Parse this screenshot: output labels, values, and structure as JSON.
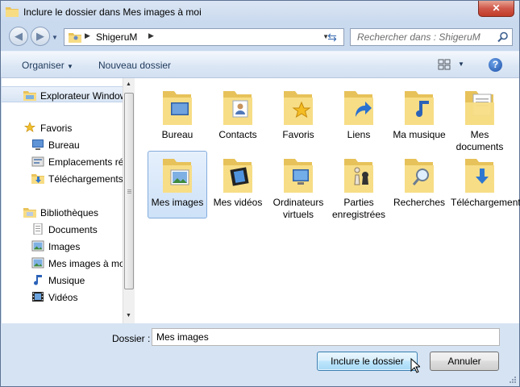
{
  "window": {
    "title": "Inclure le dossier dans Mes images à moi",
    "close_label": "✕"
  },
  "address": {
    "crumb": "ShigeruM",
    "search_placeholder": "Rechercher dans : ShigeruM"
  },
  "toolbar": {
    "organiser": "Organiser",
    "new_folder": "Nouveau dossier",
    "help": "?"
  },
  "navpane": {
    "items": [
      {
        "label": "Explorateur Windows",
        "icon": "explorer-folder-icon"
      },
      {
        "label": "Favoris",
        "icon": "favorites-star-icon"
      },
      {
        "label": "Bureau",
        "icon": "desktop-icon"
      },
      {
        "label": "Emplacements récents",
        "icon": "recent-places-icon"
      },
      {
        "label": "Téléchargements",
        "icon": "downloads-icon"
      },
      {
        "label": "Bibliothèques",
        "icon": "libraries-icon"
      },
      {
        "label": "Documents",
        "icon": "documents-icon"
      },
      {
        "label": "Images",
        "icon": "pictures-icon"
      },
      {
        "label": "Mes images à moi",
        "icon": "pictures-icon"
      },
      {
        "label": "Musique",
        "icon": "music-icon"
      },
      {
        "label": "Vidéos",
        "icon": "videos-icon"
      }
    ]
  },
  "folders": [
    {
      "label": "Bureau",
      "icon": "desktop-folder-icon"
    },
    {
      "label": "Contacts",
      "icon": "contacts-folder-icon"
    },
    {
      "label": "Favoris",
      "icon": "favorites-folder-icon"
    },
    {
      "label": "Liens",
      "icon": "links-folder-icon"
    },
    {
      "label": "Ma musique",
      "icon": "music-folder-icon"
    },
    {
      "label": "Mes documents",
      "icon": "documents-folder-icon"
    },
    {
      "label": "Mes images",
      "icon": "pictures-folder-icon",
      "selected": true
    },
    {
      "label": "Mes vidéos",
      "icon": "videos-folder-icon"
    },
    {
      "label": "Ordinateurs virtuels",
      "icon": "virtual-machines-folder-icon"
    },
    {
      "label": "Parties enregistrées",
      "icon": "saved-games-folder-icon"
    },
    {
      "label": "Recherches",
      "icon": "searches-folder-icon"
    },
    {
      "label": "Téléchargements",
      "icon": "downloads-folder-icon"
    }
  ],
  "footer": {
    "folder_label": "Dossier :",
    "folder_value": "Mes images",
    "ok_button": "Inclure le dossier",
    "cancel_button": "Annuler"
  },
  "colors": {
    "folder": "#f3d36b",
    "selection": "#cde1f8",
    "chrome": "#c9d9ee"
  }
}
